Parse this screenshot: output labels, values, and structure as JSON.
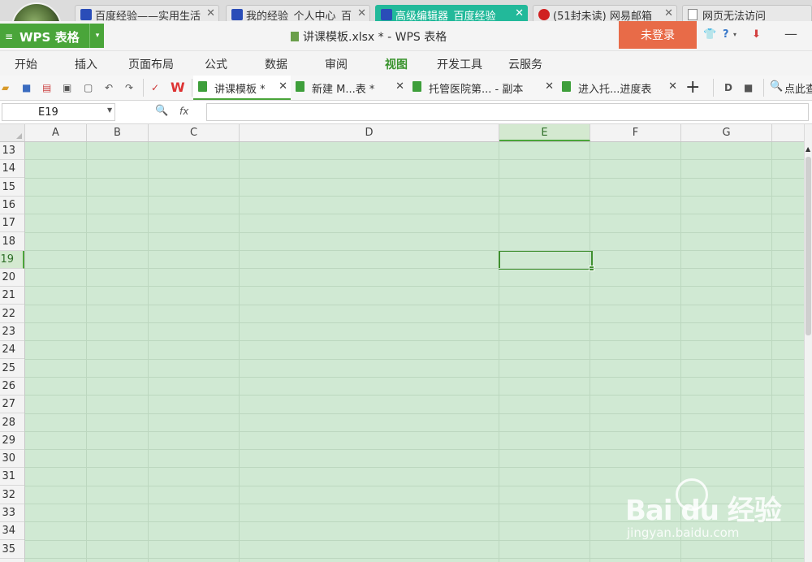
{
  "browser_tabs": [
    {
      "title": "百度经验——实用生活",
      "icon": "baidu-paw-icon"
    },
    {
      "title": "我的经验_个人中心_百",
      "icon": "baidu-paw-icon"
    },
    {
      "title": "高级编辑器_百度经验",
      "icon": "baidu-paw-icon",
      "active": true
    },
    {
      "title": "(51封未读) 网易邮箱",
      "icon": "mail-icon"
    },
    {
      "title": "网页无法访问",
      "icon": "page-icon"
    }
  ],
  "titlebar": {
    "app_name": "WPS 表格",
    "menu_lines": "≡",
    "dropdown": "▾",
    "doc_title": "讲课模板.xlsx * - WPS 表格",
    "login_label": "未登录",
    "help_label": "?",
    "minimize": "—"
  },
  "ribbon_tabs": [
    "开始",
    "插入",
    "页面布局",
    "公式",
    "数据",
    "审阅",
    "视图",
    "开发工具",
    "云服务"
  ],
  "ribbon_active": "视图",
  "doc_tabs": [
    {
      "title": "讲课模板 *",
      "active": true
    },
    {
      "title": "新建 M...表 *"
    },
    {
      "title": "托管医院第... - 副本"
    },
    {
      "title": "进入托...进度表"
    }
  ],
  "doc_tab_close": "✕",
  "new_tab": "+",
  "search": {
    "text": "点此查找"
  },
  "formula_bar": {
    "cell_ref": "E19",
    "fx": "fx",
    "content": ""
  },
  "columns": [
    "A",
    "B",
    "C",
    "D",
    "E",
    "F",
    "G"
  ],
  "selected_column": "E",
  "rows": [
    "13",
    "14",
    "15",
    "16",
    "17",
    "18",
    "19",
    "20",
    "21",
    "22",
    "23",
    "24",
    "25",
    "26",
    "27",
    "28",
    "29",
    "30",
    "31",
    "32",
    "33",
    "34",
    "35"
  ],
  "selected_row": "19",
  "watermark": {
    "logo_text": "Bai du 经验",
    "url": "jingyan.baidu.com"
  },
  "colors": {
    "wps_green": "#4aa53a",
    "grid_bg": "#d0e9d3",
    "login_bg": "#e86b48",
    "active_browser_tab": "#22b99a"
  }
}
